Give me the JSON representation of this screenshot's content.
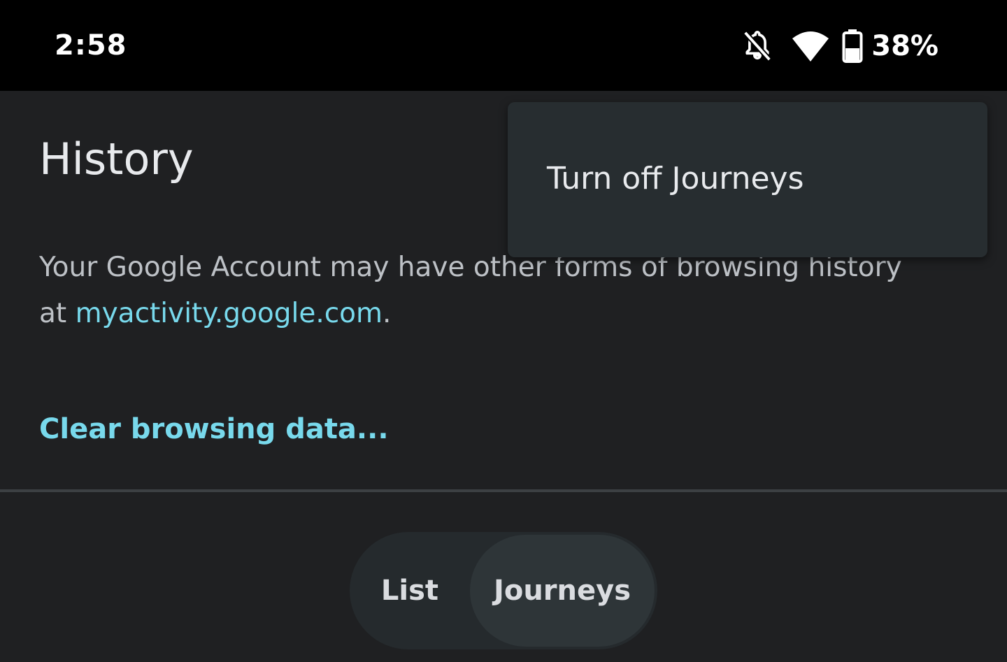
{
  "status_bar": {
    "time": "2:58",
    "battery_percent": "38%",
    "battery_level": 0.38,
    "icons": [
      "bell-off-icon",
      "wifi-icon",
      "battery-icon"
    ]
  },
  "history": {
    "title": "History",
    "info_prefix": "Your Google Account may have other forms of browsing history at ",
    "info_link": "myactivity.google.com",
    "info_suffix": ".",
    "clear_link": "Clear browsing data..."
  },
  "segmented_control": {
    "list_label": "List",
    "journeys_label": "Journeys",
    "selected": "Journeys"
  },
  "popup_menu": {
    "items": [
      {
        "label": "Turn off Journeys"
      }
    ]
  },
  "colors": {
    "background": "#1f2022",
    "status_bar": "#000000",
    "accent_link": "#78d9ec",
    "menu_background": "#272d30"
  }
}
